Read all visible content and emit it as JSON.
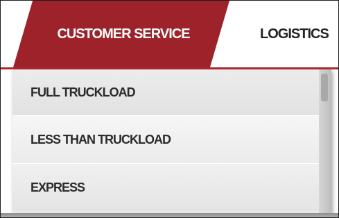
{
  "nav": {
    "tabs": [
      {
        "label": "CUSTOMER SERVICE",
        "active": true
      },
      {
        "label": "LOGISTICS",
        "active": false
      }
    ],
    "accent_color": "#9e2229"
  },
  "dropdown": {
    "items": [
      {
        "label": "FULL TRUCKLOAD"
      },
      {
        "label": "LESS THAN TRUCKLOAD"
      },
      {
        "label": "EXPRESS"
      }
    ]
  }
}
